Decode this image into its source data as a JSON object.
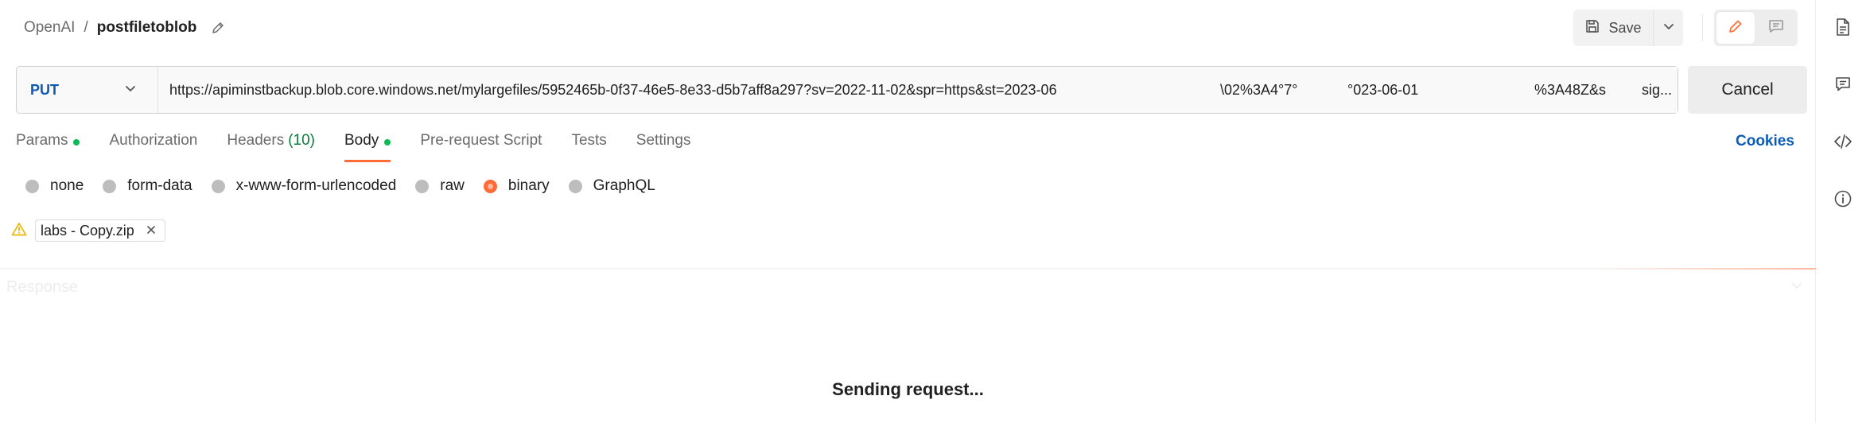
{
  "header": {
    "workspace": "OpenAI",
    "separator": "/",
    "request_name": "postfiletoblob",
    "save_label": "Save"
  },
  "request": {
    "method": "PUT",
    "url": "https://apiminstbackup.blob.core.windows.net/mylargefiles/5952465b-0f37-46e5-8e33-d5b7aff8a297?sv=2022-11-02&spr=https&st=2023-06",
    "url_fragments": [
      "\\02%3A4°7°",
      "°023-06-01",
      "%3A48Z&s",
      "sig..."
    ],
    "cancel_label": "Cancel"
  },
  "tabs": {
    "params": "Params",
    "authorization": "Authorization",
    "headers": "Headers",
    "headers_count": "(10)",
    "body": "Body",
    "prerequest": "Pre-request Script",
    "tests": "Tests",
    "settings": "Settings",
    "cookies": "Cookies"
  },
  "body_types": {
    "none": "none",
    "form_data": "form-data",
    "urlencoded": "x-www-form-urlencoded",
    "raw": "raw",
    "binary": "binary",
    "graphql": "GraphQL",
    "selected": "binary"
  },
  "file": {
    "name": "labs - Copy.zip"
  },
  "response": {
    "label": "Response",
    "status_text": "Sending request..."
  },
  "colors": {
    "accent": "#ff6c37",
    "method": "#0d5bb5",
    "active_dot": "#0cbb52",
    "warning": "#f0b400"
  },
  "icons": {
    "edit": "pencil-icon",
    "save": "floppy-icon",
    "save_menu": "chevron-down-icon",
    "mode_edit": "pencil-icon",
    "mode_comment": "comment-icon",
    "method_menu": "chevron-down-icon",
    "warning": "warning-icon",
    "remove_file": "close-icon",
    "rail": [
      "document-icon",
      "comment-icon",
      "code-icon",
      "info-icon"
    ]
  }
}
